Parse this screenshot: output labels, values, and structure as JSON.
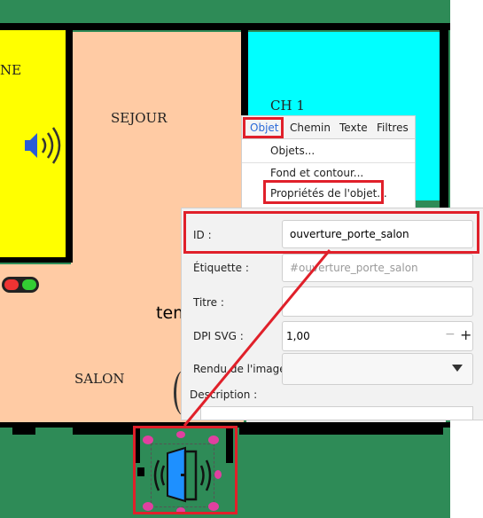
{
  "colors": {
    "background_green": "#2e8b57",
    "room_yellow": "#ffff00",
    "room_peach": "#ffcba4",
    "room_cyan": "#00ffff",
    "highlight_red": "#e0202a",
    "door_blue": "#1e90ff",
    "selection_pink": "#e040a0"
  },
  "rooms": {
    "left_partial": "NE",
    "sejour": "SEJOUR",
    "ch1": "CH 1",
    "salon": "SALON",
    "temp_partial": "tem"
  },
  "menu": {
    "items": [
      "Objet",
      "Chemin",
      "Texte",
      "Filtres"
    ],
    "active": "Objet",
    "dropdown": [
      "Objets...",
      "Fond et contour...",
      "Propriétés de l'objet..."
    ]
  },
  "properties": {
    "id_label": "ID :",
    "id_value": "ouverture_porte_salon",
    "label_label": "Étiquette :",
    "label_placeholder": "#ouverture_porte_salon",
    "title_label": "Titre :",
    "title_value": "",
    "dpi_label": "DPI SVG :",
    "dpi_value": "1,00",
    "dpi_minus": "−",
    "dpi_plus": "+",
    "render_label": "Rendu de l'image :",
    "render_value": "",
    "description_label": "Description :"
  },
  "icons": {
    "speaker": "speaker-icon",
    "door": "door-icon",
    "toggle": "toggle-icon",
    "dropdown_arrow": "chevron-down-icon"
  }
}
